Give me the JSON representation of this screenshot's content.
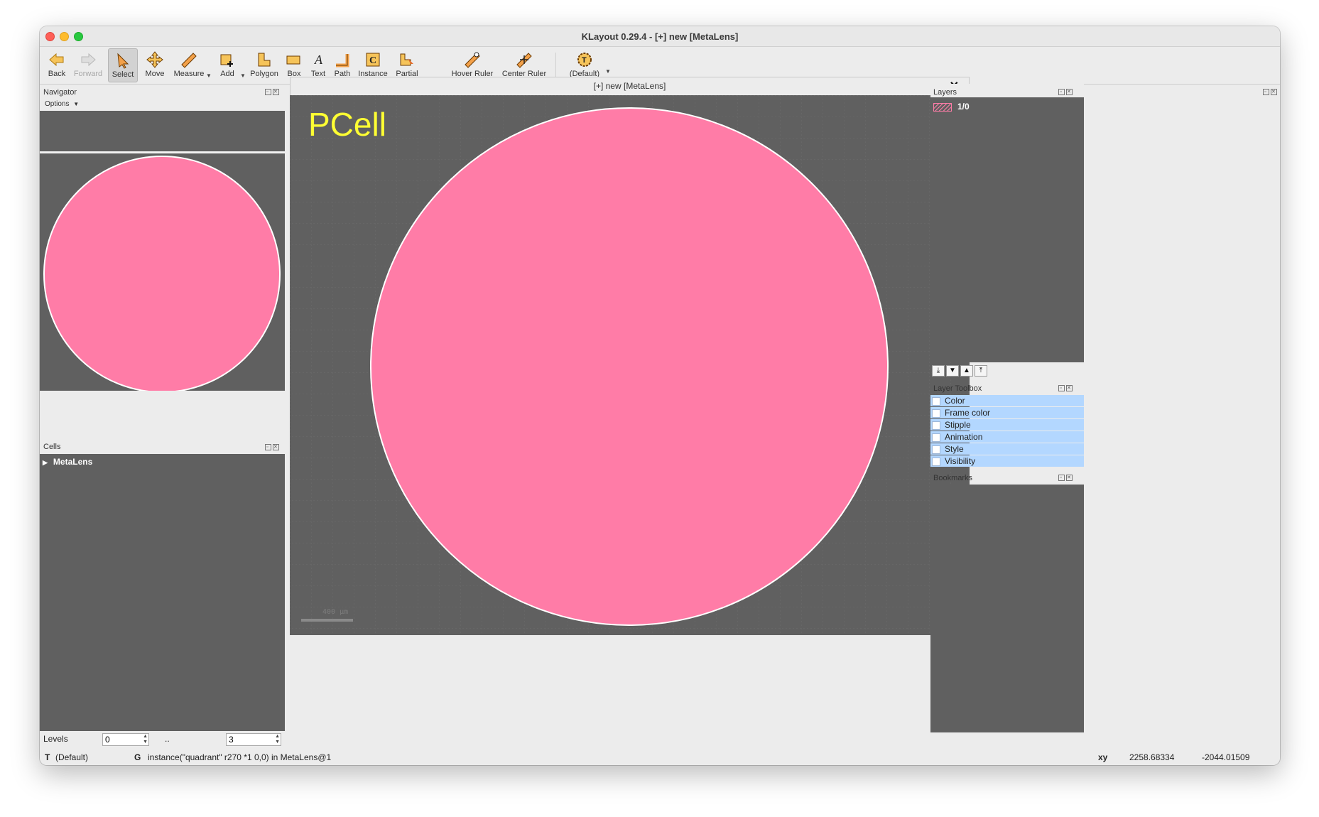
{
  "window": {
    "title": "KLayout 0.29.4 - [+] new [MetaLens]"
  },
  "toolbar": {
    "back": "Back",
    "forward": "Forward",
    "select": "Select",
    "move": "Move",
    "measure": "Measure",
    "add": "Add",
    "polygon": "Polygon",
    "box": "Box",
    "text": "Text",
    "path": "Path",
    "instance": "Instance",
    "partial": "Partial",
    "hover_ruler": "Hover Ruler",
    "center_ruler": "Center Ruler",
    "default": "(Default)"
  },
  "navigator": {
    "title": "Navigator",
    "options": "Options"
  },
  "cells": {
    "title": "Cells",
    "items": [
      {
        "name": "MetaLens"
      }
    ]
  },
  "levels": {
    "label": "Levels",
    "from": "0",
    "sep": "..",
    "to": "3"
  },
  "document": {
    "tab_title": "[+] new [MetaLens]",
    "close": "✕"
  },
  "canvas": {
    "pcell_label": "PCell",
    "scale_label": "400 µm",
    "shape_color": "#ff7ca7",
    "background": "#606060"
  },
  "layers": {
    "title": "Layers",
    "items": [
      {
        "name": "1/0"
      }
    ]
  },
  "layer_toolbox": {
    "title": "Layer Toolbox",
    "items": [
      "Color",
      "Frame color",
      "Stipple",
      "Animation",
      "Style",
      "Visibility"
    ]
  },
  "bookmarks": {
    "title": "Bookmarks"
  },
  "status": {
    "mode_key": "T",
    "mode_value": "(Default)",
    "g_key": "G",
    "message": "instance(\"quadrant\" r270 *1 0,0) in MetaLens@1",
    "xy_label": "xy",
    "x": "2258.68334",
    "y": "-2044.01509"
  }
}
